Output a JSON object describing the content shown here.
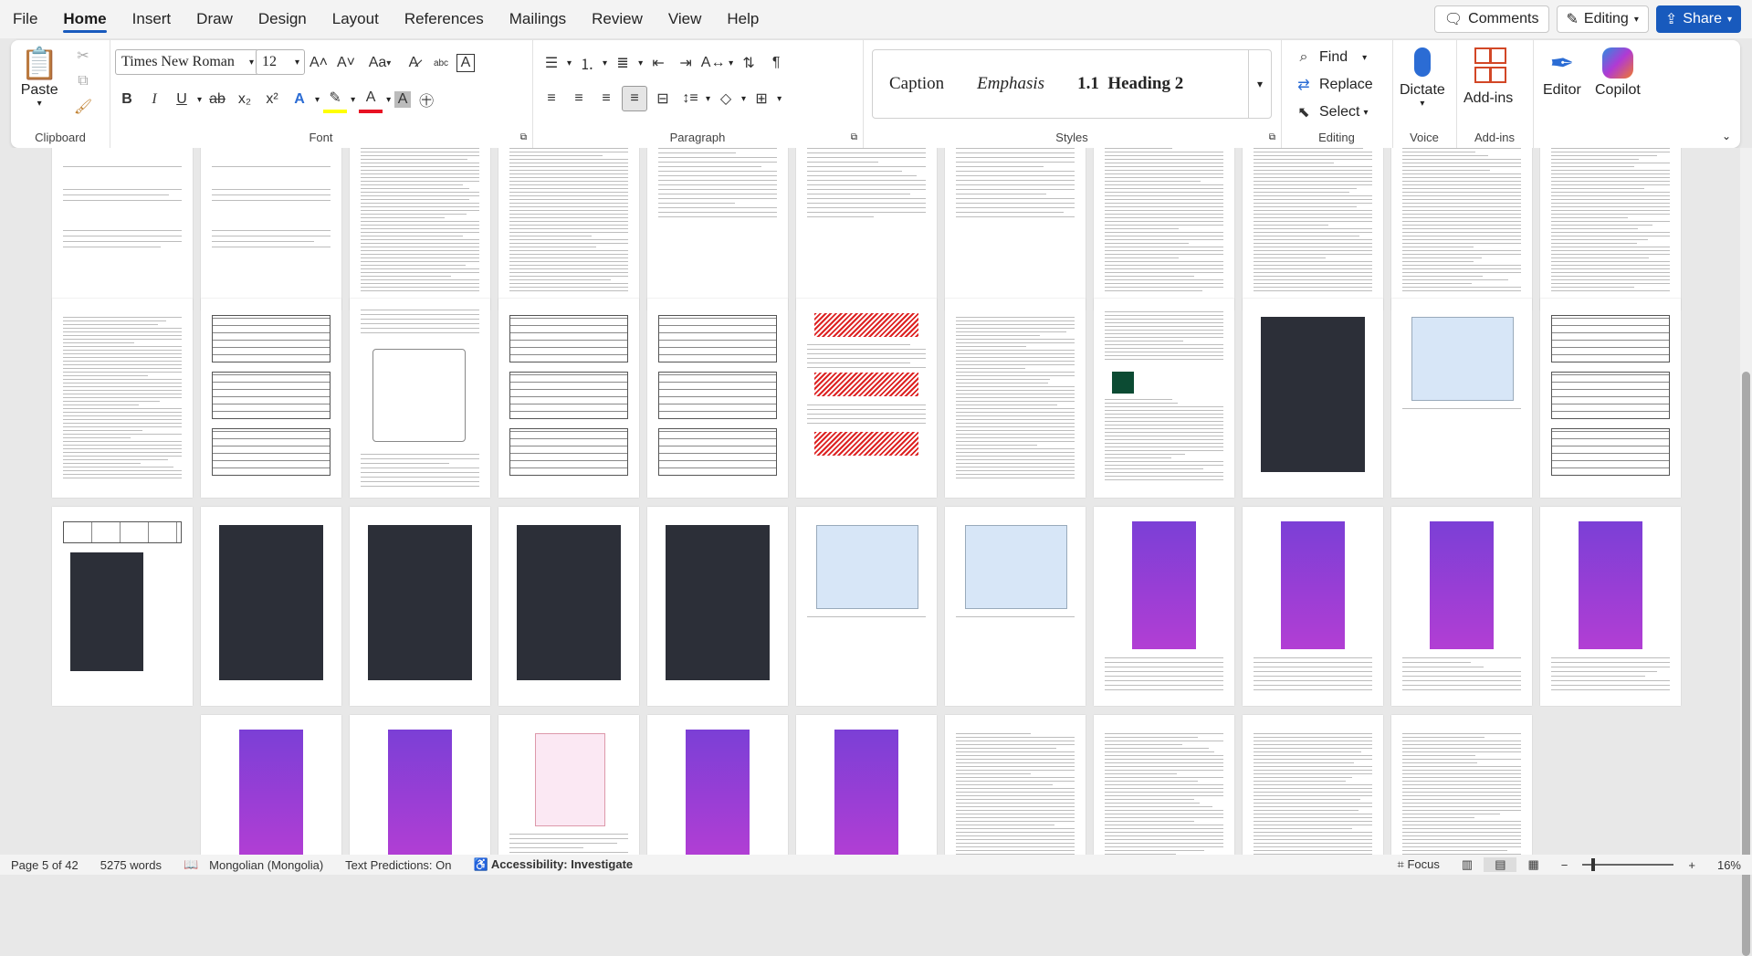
{
  "menu": {
    "items": [
      "File",
      "Home",
      "Insert",
      "Draw",
      "Design",
      "Layout",
      "References",
      "Mailings",
      "Review",
      "View",
      "Help"
    ],
    "active": "Home",
    "comments_label": "Comments",
    "editing_label": "Editing",
    "share_label": "Share"
  },
  "ribbon": {
    "clipboard": {
      "paste_label": "Paste",
      "group_label": "Clipboard"
    },
    "font": {
      "font_name": "Times New Roman",
      "font_size": "12",
      "case_label": "Aa",
      "group_label": "Font"
    },
    "paragraph": {
      "group_label": "Paragraph"
    },
    "styles": {
      "items": [
        "Caption",
        "Emphasis",
        "1.1  Heading 2"
      ],
      "group_label": "Styles"
    },
    "editing": {
      "find_label": "Find",
      "replace_label": "Replace",
      "select_label": "Select",
      "group_label": "Editing"
    },
    "voice": {
      "dictate_label": "Dictate",
      "group_label": "Voice"
    },
    "addins": {
      "addins_label": "Add-ins",
      "group_label": "Add-ins"
    },
    "editor_label": "Editor",
    "copilot_label": "Copilot"
  },
  "colors": {
    "accent": "#185abd",
    "highlight": "#ffff00",
    "font_color": "#e81123"
  },
  "statusbar": {
    "page": "Page 5 of 42",
    "words": "5275 words",
    "language": "Mongolian (Mongolia)",
    "predictions": "Text Predictions: On",
    "accessibility": "Accessibility: Investigate",
    "focus": "Focus",
    "zoom": "16%"
  }
}
